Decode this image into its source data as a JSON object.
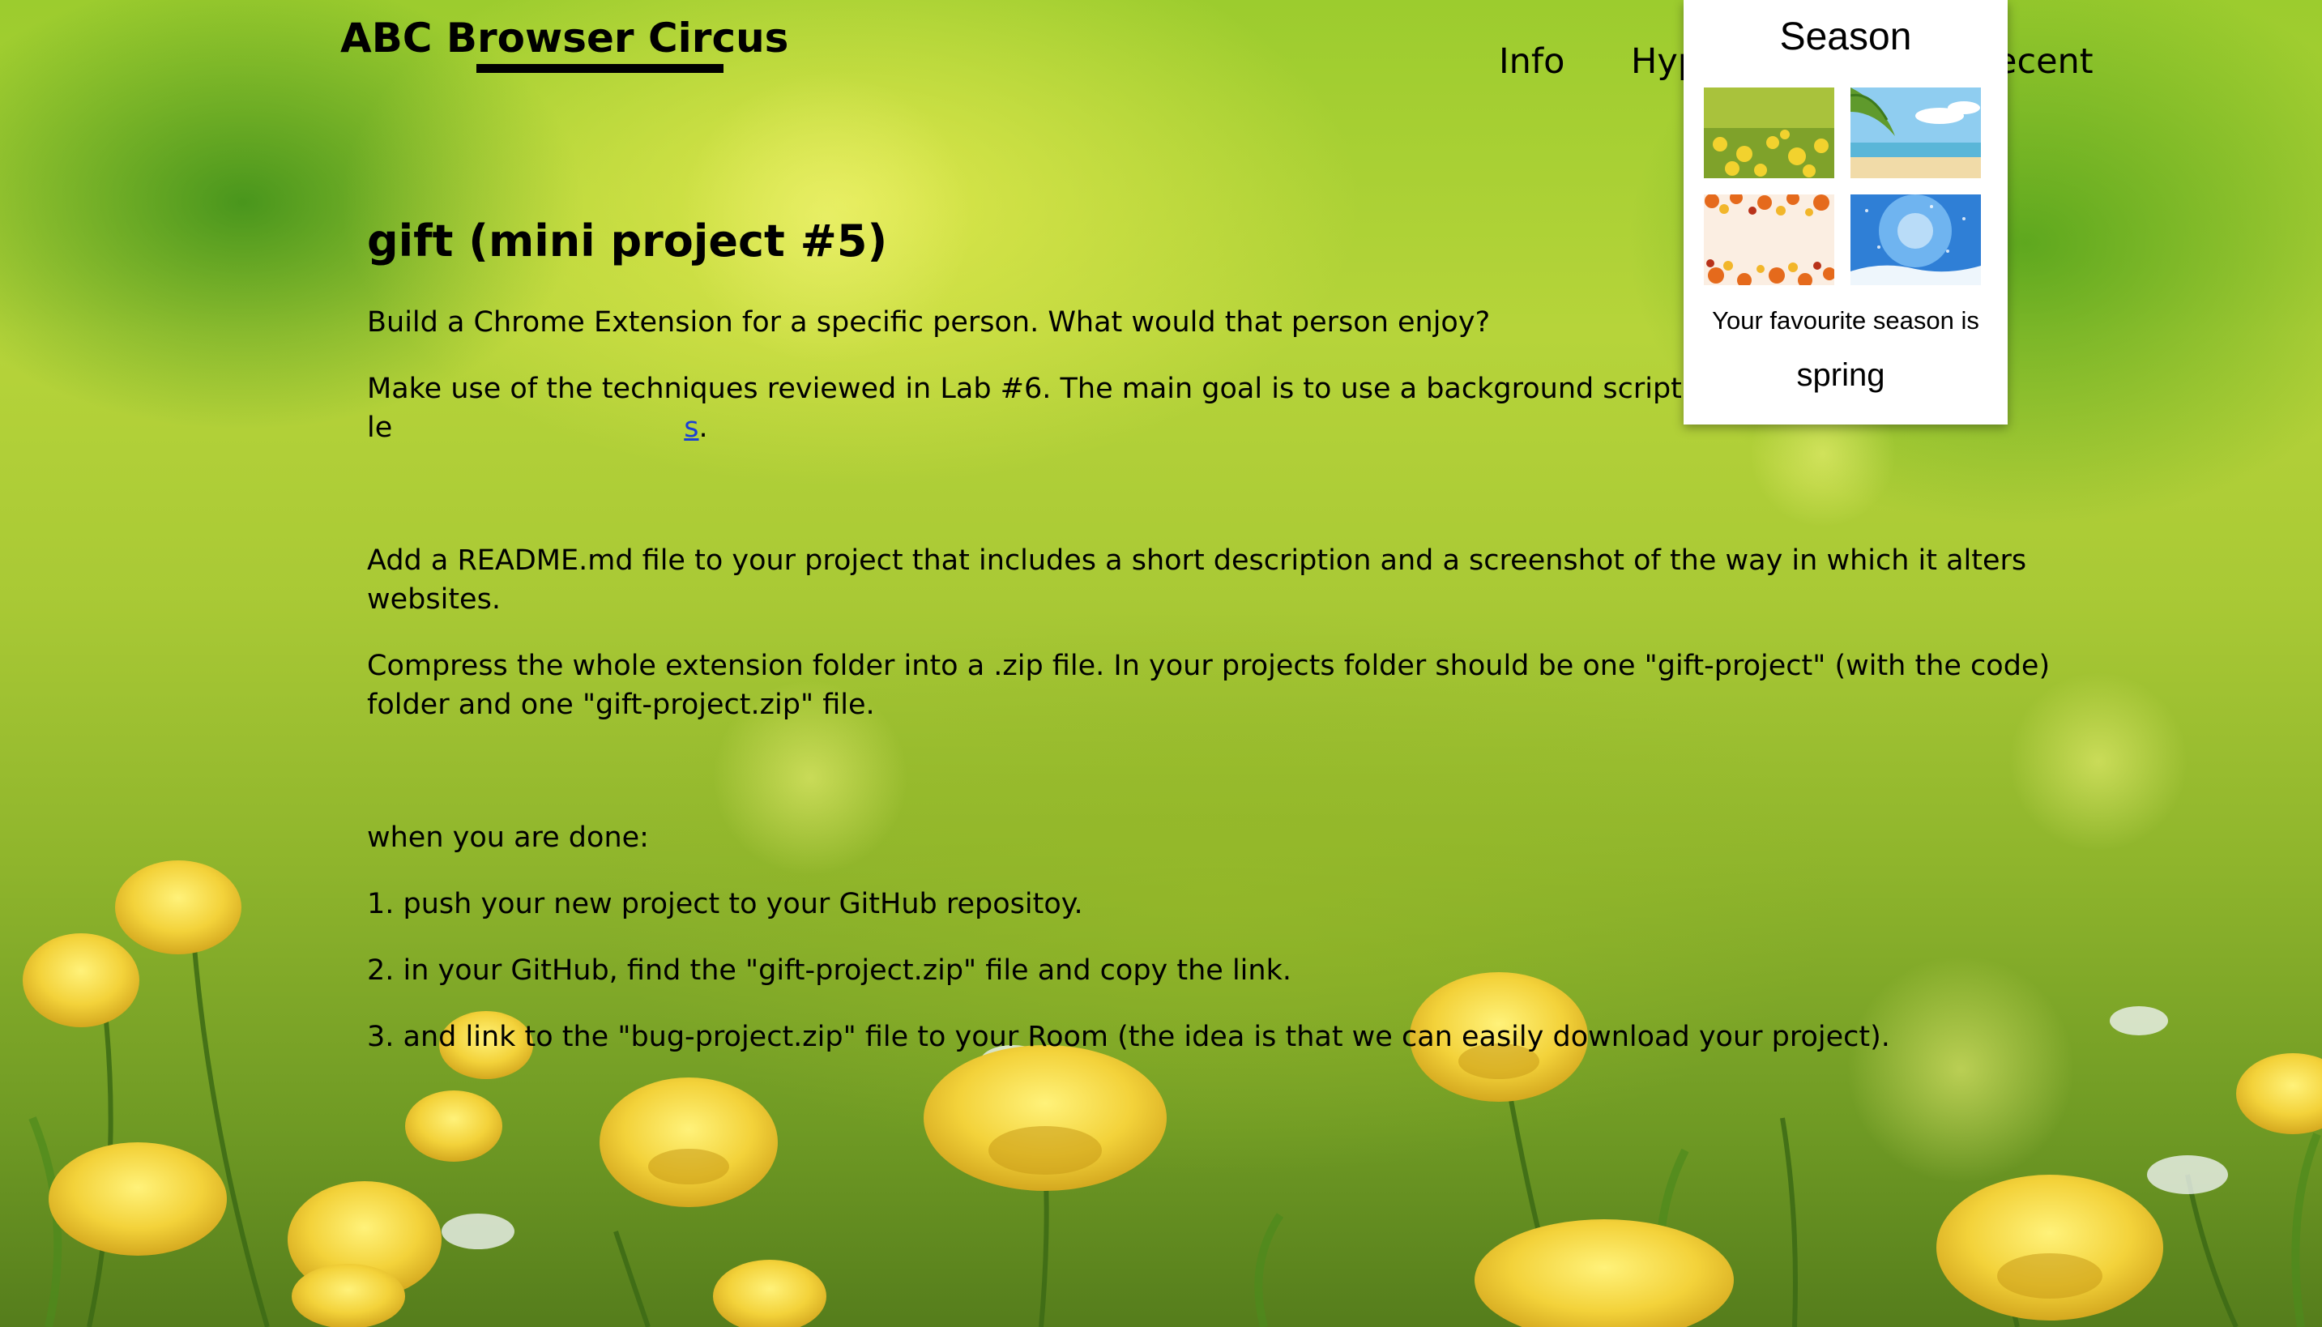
{
  "site": {
    "title": "ABC Browser Circus"
  },
  "nav": {
    "info": "Info",
    "hyp": "Hyp",
    "recent": "ecent"
  },
  "main": {
    "heading": "gift (mini project #5)",
    "p1": "Build a Chrome Extension for a specific person. What would that person enjoy?",
    "p2_text": "Make use of the techniques reviewed in Lab #6. The main goal is to use a background script and at le",
    "p2_link": "s",
    "p2_end": ".",
    "p3": "Add a README.md file to your project that includes a short description and a screenshot of the way in which it alters websites.",
    "p4": "Compress the whole extension folder into a .zip file. In your projects folder should be one \"gift-project\" (with the code) folder and one \"gift-project.zip\" file.",
    "p5": "when you are done:",
    "step1": "1. push your new project to your GitHub repositoy.",
    "step2": "2. in your GitHub, find the \"gift-project.zip\" file and copy the link.",
    "step3": "3. and link to the \"bug-project.zip\" file to your Room (the idea is that we can easily download your project)."
  },
  "popup": {
    "title": "Season",
    "thumbnails": [
      "spring-flowers-image",
      "summer-beach-image",
      "autumn-leaves-image",
      "winter-snow-image"
    ],
    "caption": "Your favourite season is",
    "value": "spring"
  },
  "colors": {
    "link": "#1a3fd6",
    "popup_bg": "#ffffff",
    "text": "#000000"
  }
}
